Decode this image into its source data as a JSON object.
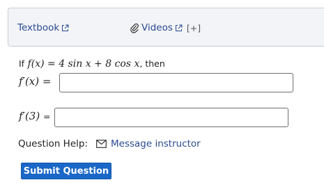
{
  "help_bar": {
    "textbook_label": "Textbook",
    "videos_label": "Videos",
    "expand_label": "[+]"
  },
  "question": {
    "prefix": "If",
    "expression_lhs": "f(x)",
    "equals": "=",
    "expression_rhs": "4 sin x + 8 cos x",
    "suffix": ", then",
    "part1_label": "f′(x) =",
    "part1_value": "",
    "part2_label": "f′(3)",
    "part2_equals": "=",
    "part2_value": ""
  },
  "question_help": {
    "label": "Question Help:",
    "message_label": "Message instructor"
  },
  "submit_label": "Submit Question",
  "colors": {
    "link": "#2a4a8f",
    "submit_bg": "#1a67c8",
    "helpbar_bg": "#f3f4f7"
  }
}
